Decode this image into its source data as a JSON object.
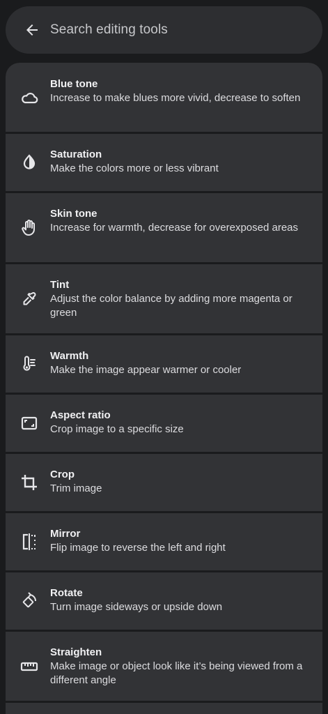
{
  "search": {
    "placeholder": "Search editing tools"
  },
  "tools": [
    {
      "name": "Blue tone",
      "description": "Increase to make blues more vivid, decrease to soften",
      "icon": "cloud-icon"
    },
    {
      "name": "Saturation",
      "description": "Make the colors more or less vibrant",
      "icon": "contrast-drop-icon"
    },
    {
      "name": "Skin tone",
      "description": "Increase for warmth, decrease for overexposed areas",
      "icon": "hand-icon"
    },
    {
      "name": "Tint",
      "description": "Adjust the color balance by adding more magenta or green",
      "icon": "eyedropper-icon"
    },
    {
      "name": "Warmth",
      "description": "Make the image appear warmer or cooler",
      "icon": "thermometer-icon"
    },
    {
      "name": "Aspect ratio",
      "description": "Crop image to a specific size",
      "icon": "aspect-ratio-icon"
    },
    {
      "name": "Crop",
      "description": "Trim image",
      "icon": "crop-icon"
    },
    {
      "name": "Mirror",
      "description": "Flip image to reverse the left and right",
      "icon": "mirror-icon"
    },
    {
      "name": "Rotate",
      "description": "Turn image sideways or upside down",
      "icon": "rotate-icon"
    },
    {
      "name": "Straighten",
      "description": "Make image or object look like it’s being viewed from a different angle",
      "icon": "ruler-icon"
    }
  ]
}
